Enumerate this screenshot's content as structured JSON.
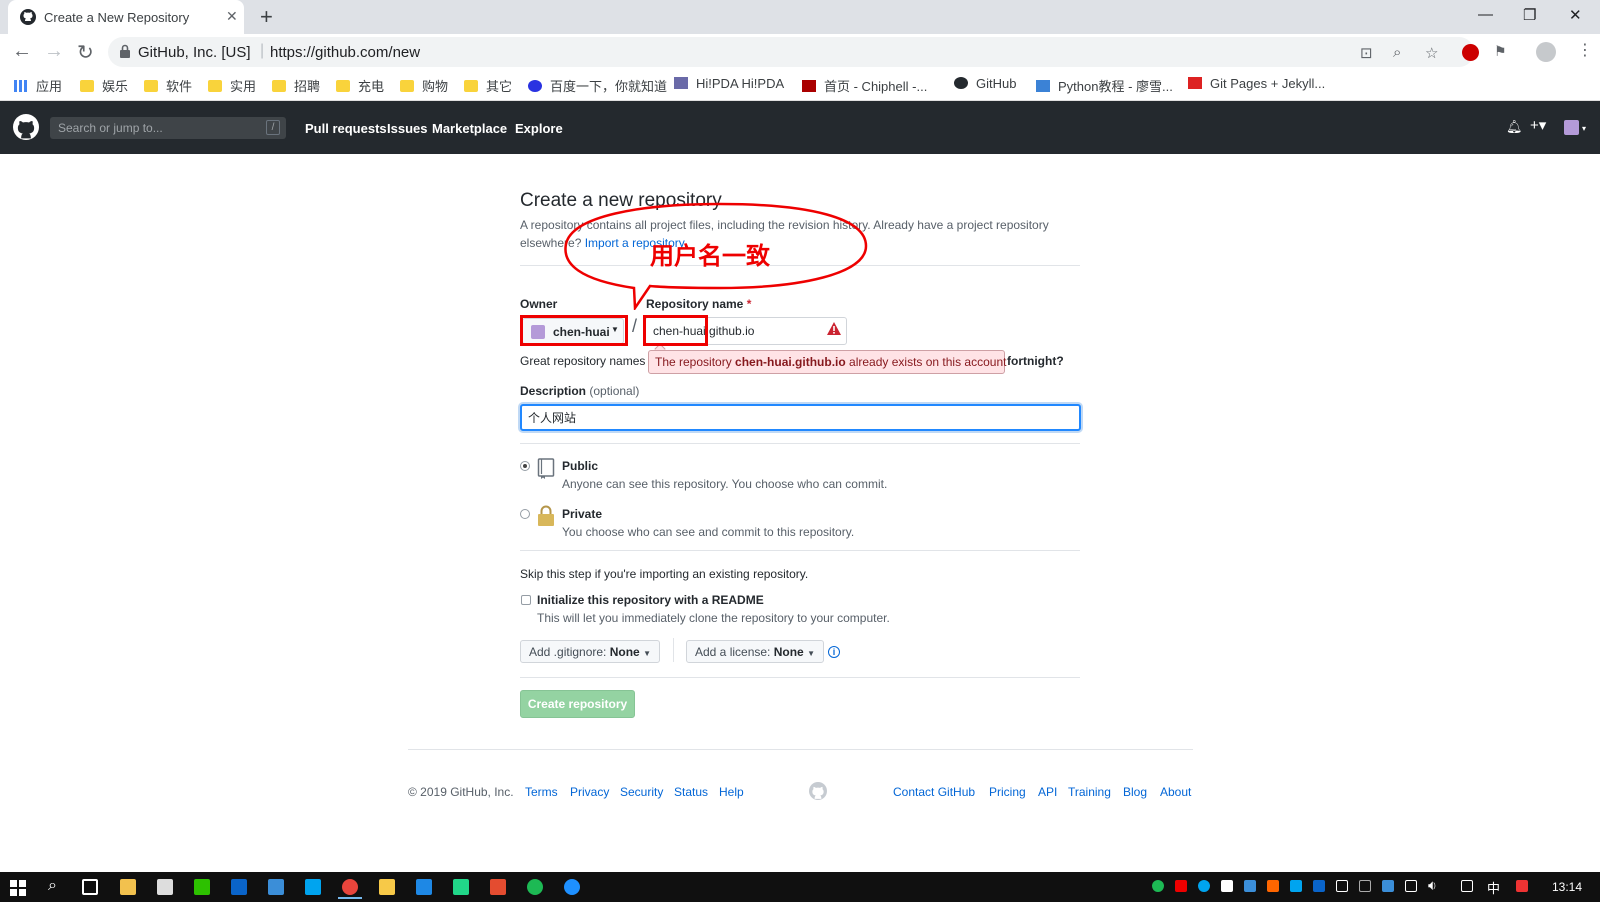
{
  "browser": {
    "tab_title": "Create a New Repository",
    "site_identity": "GitHub, Inc. [US]",
    "url": "https://github.com/new"
  },
  "bookmarks": [
    "应用",
    "娱乐",
    "软件",
    "实用",
    "招聘",
    "充电",
    "购物",
    "其它",
    "百度一下，你就知道",
    "Hi!PDA Hi!PDA",
    "首页 - Chiphell -...",
    "GitHub",
    "Python教程 - 廖雪...",
    "Git Pages + Jekyll..."
  ],
  "github_header": {
    "search_placeholder": "Search or jump to...",
    "search_shortcut": "/",
    "nav": [
      "Pull requests",
      "Issues",
      "Marketplace",
      "Explore"
    ]
  },
  "form": {
    "title": "Create a new repository",
    "subtitle": "A repository contains all project files, including the revision history. Already have a project repository elsewhere?",
    "import_link": "Import a repository.",
    "owner_label": "Owner",
    "owner_value": "chen-huai",
    "repo_label": "Repository name",
    "repo_required": "*",
    "repo_value": "chen-huai.github.io",
    "hint_start": "Great repository names",
    "hint_end": "fortnight?",
    "error_pre": "The repository",
    "error_name": "chen-huai.github.io",
    "error_post": "already exists on this account",
    "desc_label": "Description",
    "desc_optional": "(optional)",
    "desc_value": "个人网站",
    "public_title": "Public",
    "public_desc": "Anyone can see this repository. You choose who can commit.",
    "private_title": "Private",
    "private_desc": "You choose who can see and commit to this repository.",
    "skip_text": "Skip this step if you're importing an existing repository.",
    "init_title": "Initialize this repository with a README",
    "init_desc": "This will let you immediately clone the repository to your computer.",
    "gitignore_label": "Add .gitignore:",
    "gitignore_value": "None",
    "license_label": "Add a license:",
    "license_value": "None",
    "info": "i",
    "create_button": "Create repository",
    "visibility_selected": "public",
    "readme_checked": false
  },
  "annotation": {
    "text": "用户名一致",
    "color": "#e00000"
  },
  "footer": {
    "copyright": "© 2019 GitHub, Inc.",
    "left_links": [
      "Terms",
      "Privacy",
      "Security",
      "Status",
      "Help"
    ],
    "right_links": [
      "Contact GitHub",
      "Pricing",
      "API",
      "Training",
      "Blog",
      "About"
    ]
  },
  "taskbar": {
    "ime": "中",
    "time": "13:14"
  },
  "colors": {
    "gh_header": "#24292e",
    "link": "#0366d6",
    "create_button": "#94d3a2",
    "error_bg": "#ffe3e6"
  }
}
